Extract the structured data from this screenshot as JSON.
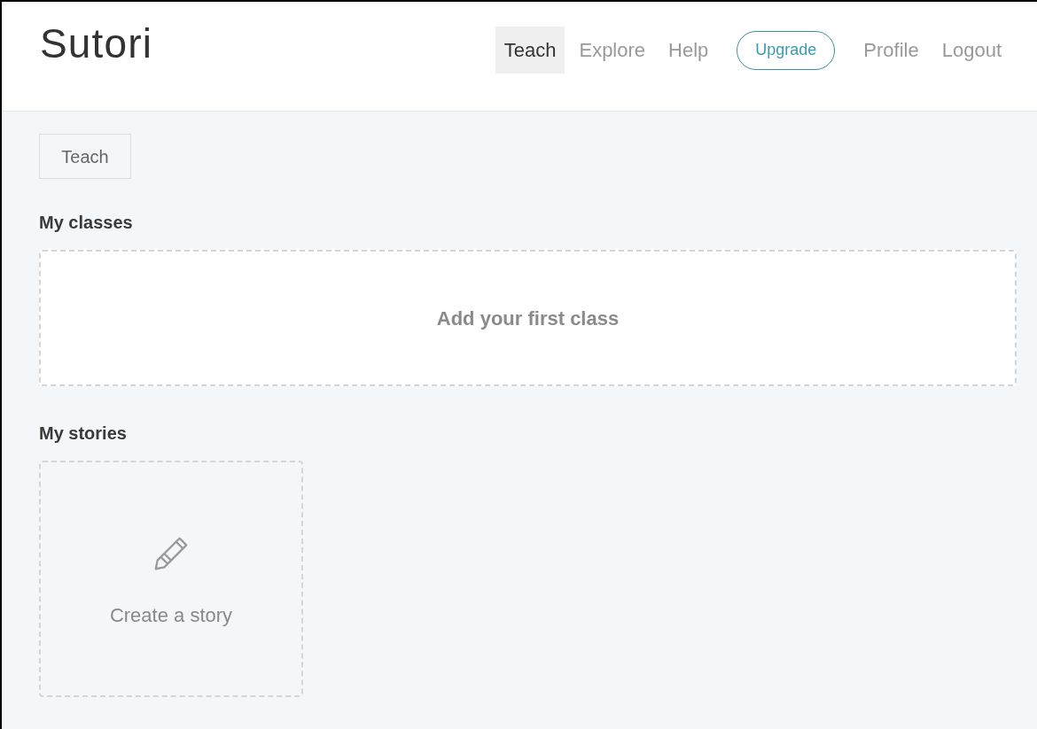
{
  "logo": "Sutori",
  "nav": [
    {
      "label": "Teach",
      "kind": "link",
      "selected": true
    },
    {
      "label": "Explore",
      "kind": "link",
      "selected": false
    },
    {
      "label": "Help",
      "kind": "link",
      "selected": false
    },
    {
      "label": "Upgrade",
      "kind": "pill",
      "selected": false
    },
    {
      "label": "Profile",
      "kind": "link",
      "selected": false
    },
    {
      "label": "Logout",
      "kind": "link",
      "selected": false
    }
  ],
  "breadcrumb": "Teach",
  "classes": {
    "heading": "My classes",
    "add_label": "Add your first class"
  },
  "stories": {
    "heading": "My stories",
    "create_label": "Create a story"
  }
}
